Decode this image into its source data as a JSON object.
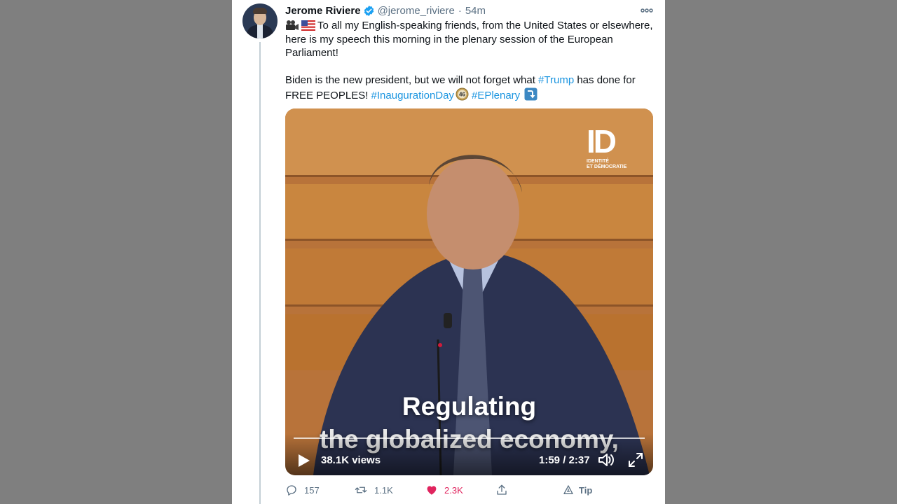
{
  "tweet": {
    "author": {
      "name": "Jerome Riviere",
      "handle": "@jerome_riviere",
      "time": "54m",
      "separator": "·"
    },
    "icons": {
      "verified": "verified-badge-icon",
      "more": "more-options-icon",
      "camera": "movie-camera-emoji",
      "flag": "us-flag-emoji",
      "badge46": "circled-46-emoji",
      "down_arrow": "right-arrow-curving-down-emoji"
    },
    "text": {
      "p1": "To all my English-speaking friends, from the United States or elsewhere, here is my speech this morning in the plenary session of the European Parliament!",
      "p2_a": "Biden is the new president, but we will not forget what ",
      "hashtag_trump": "#Trump",
      "p2_b": " has done for FREE PEOPLES! ",
      "hashtag_inauguration": "#InaugurationDay",
      "hashtag_eplenary": "#EPlenary"
    },
    "video": {
      "logo_mark": "ID",
      "logo_sub1": "IDENTITÉ",
      "logo_sub2": "ET DÉMOCRATIE",
      "subtitle_line1": "Regulating",
      "subtitle_line2": "the globalized economy,",
      "views": "38.1K views",
      "time": "1:59 / 2:37"
    },
    "actions": {
      "reply_count": "157",
      "retweet_count": "1.1K",
      "like_count": "2.3K",
      "tip_label": "Tip"
    }
  },
  "colors": {
    "background": "#7f7f7f",
    "link": "#1b95e0",
    "like": "#e0245e",
    "verified": "#1da1f2",
    "muted": "#5b7083"
  }
}
